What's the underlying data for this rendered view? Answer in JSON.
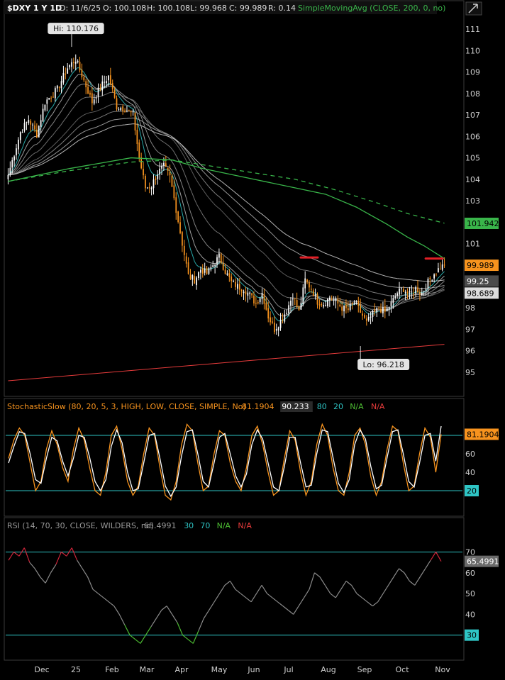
{
  "header": {
    "symbol": "$DXY 1 Y 1D",
    "date": "D: 11/6/25",
    "open": "O: 100.108",
    "high": "H: 100.108",
    "low": "L: 99.968",
    "close": "C: 99.989",
    "range": "R: 0.14",
    "study": "SimpleMovingAvg (CLOSE, 200, 0, no)"
  },
  "colors": {
    "background": "#000000",
    "up": "#ffffff",
    "down": "#f7931e",
    "sma200": "#39b54a",
    "trendline": "#e63b3b",
    "marker": "#e21f26",
    "stoch_k": "#f7931e",
    "stoch_d": "#ffffff",
    "ref_line": "#2ec4c4",
    "rsi": "#8a8a8a",
    "rsi_overbought": "#d0253a",
    "rsi_oversold": "#4dbd33"
  },
  "chart_data": [
    {
      "type": "candlestick",
      "title": "$DXY 1 Y 1D",
      "ylim": [
        94.5,
        111.7
      ],
      "yticks": [
        "111",
        "110",
        "109",
        "108",
        "107",
        "106",
        "105",
        "104",
        "103",
        "101",
        "98",
        "97",
        "96",
        "95"
      ],
      "xticks": [
        "Dec",
        "25",
        "Feb",
        "Mar",
        "Apr",
        "May",
        "Jun",
        "Jul",
        "Aug",
        "Sep",
        "Oct",
        "Nov"
      ],
      "anchors": [
        {
          "x": 0,
          "y": 104.2
        },
        {
          "x": 6,
          "y": 106.2
        },
        {
          "x": 10,
          "y": 106.8
        },
        {
          "x": 14,
          "y": 106.1
        },
        {
          "x": 18,
          "y": 107.6
        },
        {
          "x": 24,
          "y": 108.2
        },
        {
          "x": 29,
          "y": 109.2
        },
        {
          "x": 33,
          "y": 109.6
        },
        {
          "x": 37,
          "y": 108.6
        },
        {
          "x": 41,
          "y": 107.6
        },
        {
          "x": 45,
          "y": 108.3
        },
        {
          "x": 49,
          "y": 108.8
        },
        {
          "x": 53,
          "y": 107.4
        },
        {
          "x": 57,
          "y": 107.3
        },
        {
          "x": 61,
          "y": 107.0
        },
        {
          "x": 64,
          "y": 105.0
        },
        {
          "x": 67,
          "y": 103.6
        },
        {
          "x": 70,
          "y": 103.7
        },
        {
          "x": 73,
          "y": 104.3
        },
        {
          "x": 76,
          "y": 104.6
        },
        {
          "x": 79,
          "y": 104.1
        },
        {
          "x": 82,
          "y": 102.6
        },
        {
          "x": 85,
          "y": 101.0
        },
        {
          "x": 88,
          "y": 99.5
        },
        {
          "x": 91,
          "y": 99.3
        },
        {
          "x": 94,
          "y": 99.8
        },
        {
          "x": 97,
          "y": 99.6
        },
        {
          "x": 100,
          "y": 100.0
        },
        {
          "x": 103,
          "y": 100.4
        },
        {
          "x": 106,
          "y": 99.7
        },
        {
          "x": 109,
          "y": 99.2
        },
        {
          "x": 112,
          "y": 99.0
        },
        {
          "x": 115,
          "y": 98.9
        },
        {
          "x": 118,
          "y": 98.6
        },
        {
          "x": 121,
          "y": 98.2
        },
        {
          "x": 124,
          "y": 98.7
        },
        {
          "x": 127,
          "y": 97.6
        },
        {
          "x": 130,
          "y": 97.0
        },
        {
          "x": 133,
          "y": 97.4
        },
        {
          "x": 136,
          "y": 97.9
        },
        {
          "x": 139,
          "y": 98.6
        },
        {
          "x": 142,
          "y": 97.8
        },
        {
          "x": 145,
          "y": 99.3
        },
        {
          "x": 148,
          "y": 98.9
        },
        {
          "x": 151,
          "y": 98.3
        },
        {
          "x": 154,
          "y": 98.2
        },
        {
          "x": 157,
          "y": 98.5
        },
        {
          "x": 160,
          "y": 98.3
        },
        {
          "x": 163,
          "y": 98.0
        },
        {
          "x": 166,
          "y": 97.9
        },
        {
          "x": 169,
          "y": 98.3
        },
        {
          "x": 172,
          "y": 97.8
        },
        {
          "x": 175,
          "y": 97.3
        },
        {
          "x": 178,
          "y": 97.7
        },
        {
          "x": 181,
          "y": 98.0
        },
        {
          "x": 184,
          "y": 97.8
        },
        {
          "x": 187,
          "y": 98.2
        },
        {
          "x": 190,
          "y": 98.7
        },
        {
          "x": 193,
          "y": 98.9
        },
        {
          "x": 196,
          "y": 98.6
        },
        {
          "x": 199,
          "y": 98.9
        },
        {
          "x": 202,
          "y": 98.7
        },
        {
          "x": 205,
          "y": 99.2
        },
        {
          "x": 208,
          "y": 99.6
        },
        {
          "x": 211,
          "y": 99.9
        },
        {
          "x": 213,
          "y": 99.99
        }
      ],
      "markers": [
        {
          "label": "Hi: 110.176",
          "x": 31,
          "y": 110.176
        },
        {
          "label": "Lo: 96.218",
          "x": 172,
          "y": 96.218
        }
      ],
      "red_marks": [
        {
          "x": 147,
          "y": 100.35
        },
        {
          "x": 208,
          "y": 100.3
        }
      ],
      "sma200_solid": [
        {
          "x": 0,
          "y": 103.9
        },
        {
          "x": 30,
          "y": 104.5
        },
        {
          "x": 60,
          "y": 105.0
        },
        {
          "x": 80,
          "y": 104.9
        },
        {
          "x": 95,
          "y": 104.5
        },
        {
          "x": 110,
          "y": 104.2
        },
        {
          "x": 125,
          "y": 103.9
        },
        {
          "x": 140,
          "y": 103.6
        },
        {
          "x": 155,
          "y": 103.3
        },
        {
          "x": 170,
          "y": 102.7
        },
        {
          "x": 185,
          "y": 101.9
        },
        {
          "x": 195,
          "y": 101.3
        },
        {
          "x": 203,
          "y": 100.9
        },
        {
          "x": 213,
          "y": 100.3
        }
      ],
      "sma200_dashed": [
        {
          "x": 0,
          "y": 103.9
        },
        {
          "x": 30,
          "y": 104.4
        },
        {
          "x": 60,
          "y": 104.8
        },
        {
          "x": 80,
          "y": 104.9
        },
        {
          "x": 100,
          "y": 104.6
        },
        {
          "x": 120,
          "y": 104.3
        },
        {
          "x": 140,
          "y": 104.0
        },
        {
          "x": 160,
          "y": 103.5
        },
        {
          "x": 180,
          "y": 102.9
        },
        {
          "x": 195,
          "y": 102.4
        },
        {
          "x": 205,
          "y": 102.15
        },
        {
          "x": 213,
          "y": 101.95
        }
      ],
      "trendline": [
        {
          "x": 0,
          "y": 94.6
        },
        {
          "x": 213,
          "y": 96.3
        }
      ],
      "price_labels": [
        {
          "text": "101.942",
          "value": 101.942,
          "color": "#39b54a"
        },
        {
          "text": "99.989",
          "value": 99.989,
          "color": "#f7931e"
        },
        {
          "text": "99.25",
          "value": 99.25,
          "color": "#4a4a4a"
        },
        {
          "text": "98.689",
          "value": 98.689,
          "color": "#dcdcdc"
        }
      ]
    },
    {
      "type": "line",
      "title": "StochasticSlow (80, 20, 5, 3, HIGH, LOW, CLOSE, SIMPLE, No)",
      "legend_values": [
        "81.1904",
        "90.233",
        "80",
        "20",
        "N/A",
        "N/A"
      ],
      "ylim": [
        0,
        100
      ],
      "yticks": [
        "60",
        "40"
      ],
      "ref_lines": [
        80,
        20
      ],
      "ref_labels": [
        "20"
      ],
      "current_label": "81.1904",
      "series": [
        {
          "name": "",
          "values": [
            55,
            75,
            88,
            80,
            50,
            20,
            30,
            65,
            85,
            70,
            45,
            30,
            65,
            88,
            75,
            45,
            20,
            15,
            40,
            80,
            90,
            65,
            30,
            15,
            25,
            60,
            88,
            80,
            45,
            15,
            10,
            30,
            70,
            92,
            85,
            50,
            20,
            25,
            60,
            85,
            80,
            50,
            30,
            20,
            45,
            80,
            90,
            70,
            40,
            15,
            20,
            55,
            85,
            75,
            40,
            15,
            30,
            70,
            92,
            80,
            45,
            20,
            15,
            40,
            80,
            88,
            70,
            35,
            15,
            30,
            65,
            90,
            85,
            50,
            20,
            25,
            60,
            88,
            78,
            40,
            81
          ]
        },
        {
          "name": "",
          "values": [
            50,
            68,
            84,
            82,
            60,
            32,
            28,
            55,
            78,
            74,
            52,
            36,
            55,
            80,
            78,
            56,
            30,
            20,
            32,
            68,
            86,
            72,
            40,
            20,
            22,
            50,
            80,
            82,
            55,
            25,
            14,
            24,
            58,
            84,
            86,
            60,
            30,
            24,
            50,
            78,
            82,
            60,
            36,
            24,
            38,
            70,
            86,
            76,
            50,
            24,
            20,
            46,
            78,
            78,
            50,
            24,
            26,
            60,
            86,
            84,
            56,
            28,
            18,
            32,
            70,
            86,
            76,
            46,
            22,
            26,
            56,
            84,
            86,
            60,
            30,
            24,
            50,
            80,
            82,
            52,
            90
          ]
        }
      ]
    },
    {
      "type": "line",
      "title": "RSI (14, 70, 30, CLOSE, WILDERS, no)",
      "legend_values": [
        "65.4991",
        "30",
        "70",
        "N/A",
        "N/A"
      ],
      "ylim": [
        20,
        78
      ],
      "yticks": [
        "70",
        "60",
        "50",
        "40"
      ],
      "ref_lines": [
        70,
        30
      ],
      "ref_labels": [
        "30"
      ],
      "current_label": "65.4991",
      "series": [
        {
          "name": "RSI",
          "values": [
            66,
            70,
            68,
            72,
            65,
            62,
            58,
            55,
            60,
            64,
            70,
            68,
            72,
            66,
            62,
            58,
            52,
            50,
            48,
            46,
            44,
            40,
            35,
            30,
            28,
            26,
            30,
            34,
            38,
            42,
            44,
            40,
            36,
            30,
            28,
            26,
            32,
            38,
            42,
            46,
            50,
            54,
            56,
            52,
            50,
            48,
            46,
            50,
            54,
            50,
            48,
            46,
            44,
            42,
            40,
            44,
            48,
            52,
            60,
            58,
            54,
            50,
            48,
            52,
            56,
            54,
            50,
            48,
            46,
            44,
            46,
            50,
            54,
            58,
            62,
            60,
            56,
            54,
            58,
            62,
            66,
            70,
            65.5
          ]
        }
      ]
    }
  ]
}
